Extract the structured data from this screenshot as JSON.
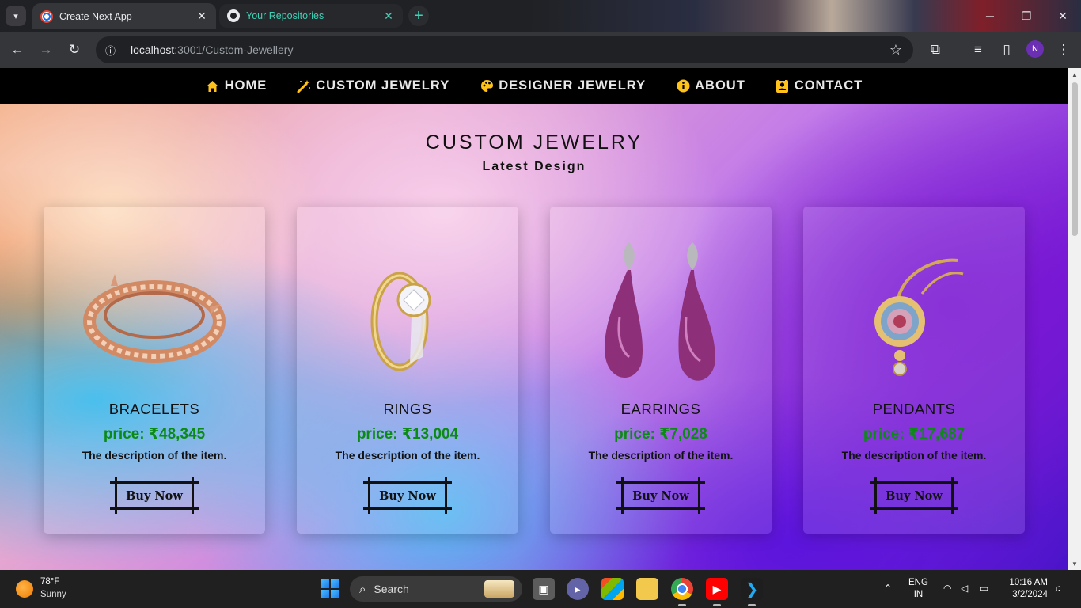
{
  "browser": {
    "tabs": [
      {
        "title": "Create Next App",
        "active": true,
        "favicon": "nextjs-chrome-icon"
      },
      {
        "title": "Your Repositories",
        "active": false,
        "favicon": "github-icon"
      }
    ],
    "url_host": "localhost",
    "url_path": ":3001/Custom-Jewellery",
    "profile_initial": "N"
  },
  "nav": {
    "items": [
      {
        "label": "HOME",
        "icon": "home-icon"
      },
      {
        "label": "CUSTOM JEWELRY",
        "icon": "magic-wand-icon"
      },
      {
        "label": "DESIGNER JEWELRY",
        "icon": "palette-icon"
      },
      {
        "label": "ABOUT",
        "icon": "info-icon"
      },
      {
        "label": "CONTACT",
        "icon": "contact-card-icon"
      }
    ]
  },
  "page": {
    "title": "CUSTOM JEWELRY",
    "subtitle": "Latest Design"
  },
  "products": [
    {
      "name": "BRACELETS",
      "price": "price: ₹48,345",
      "description": "The description of the item.",
      "button": "Buy Now"
    },
    {
      "name": "RINGS",
      "price": "price: ₹13,004",
      "description": "The description of the item.",
      "button": "Buy Now"
    },
    {
      "name": "EARRINGS",
      "price": "price: ₹7,028",
      "description": "The description of the item.",
      "button": "Buy Now"
    },
    {
      "name": "PENDANTS",
      "price": "price: ₹17,687",
      "description": "The description of the item.",
      "button": "Buy Now"
    }
  ],
  "taskbar": {
    "weather_temp": "78°F",
    "weather_cond": "Sunny",
    "search_label": "Search",
    "lang_top": "ENG",
    "lang_bottom": "IN",
    "time": "10:16 AM",
    "date": "3/2/2024"
  },
  "colors": {
    "price": "#0c8a16",
    "nav_icon": "#ffc21a",
    "navbar_bg": "#000000"
  }
}
